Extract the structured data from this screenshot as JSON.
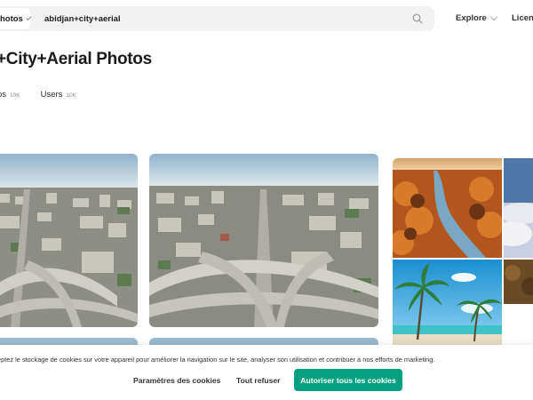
{
  "header": {
    "media_type": "hotos",
    "search_value": "abidjan+city+aerial",
    "explore": "Explore",
    "license": "Licens"
  },
  "page": {
    "title": "+City+Aerial Photos"
  },
  "tabs": [
    {
      "label": "os",
      "count": "10K"
    },
    {
      "label": "Users",
      "count": "10K"
    }
  ],
  "cookie_banner": {
    "text": "eptez le stockage de cookies sur votre appareil pour améliorer la navigation sur le site, analyser son utilisation et contribuer à nos efforts de marketing.",
    "settings_label": "Paramètres des cookies",
    "refuse_label": "Tout refuser",
    "accept_label": "Autoriser tous les cookies",
    "accept_color": "#05a081"
  }
}
